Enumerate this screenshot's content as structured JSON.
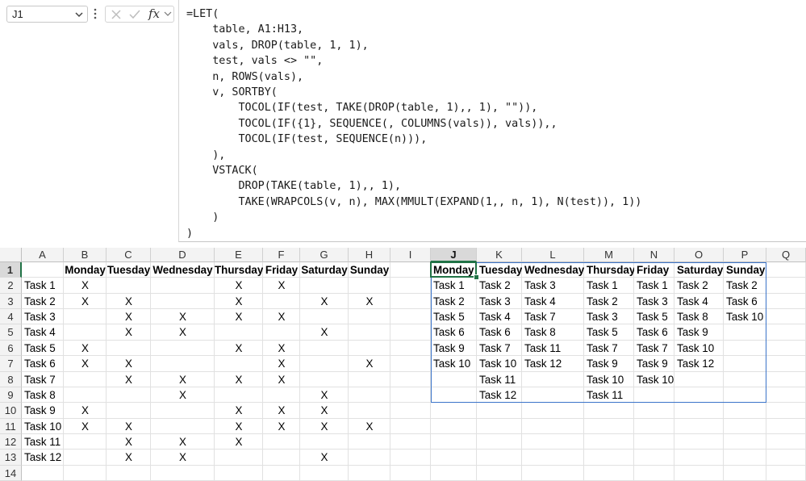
{
  "name_box": {
    "value": "J1"
  },
  "formula_bar": {
    "fx_label": "fx",
    "lines": [
      "=LET(",
      "    table, A1:H13,",
      "    vals, DROP(table, 1, 1),",
      "    test, vals <> \"\",",
      "    n, ROWS(vals),",
      "    v, SORTBY(",
      "        TOCOL(IF(test, TAKE(DROP(table, 1),, 1), \"\")),",
      "        TOCOL(IF({1}, SEQUENCE(, COLUMNS(vals)), vals)),,",
      "        TOCOL(IF(test, SEQUENCE(n))),",
      "    ),",
      "    VSTACK(",
      "        DROP(TAKE(table, 1),, 1),",
      "        TAKE(WRAPCOLS(v, n), MAX(MMULT(EXPAND(1,, n, 1), N(test)), 1))",
      "    )",
      ")"
    ]
  },
  "grid": {
    "columns": [
      "A",
      "B",
      "C",
      "D",
      "E",
      "F",
      "G",
      "H",
      "I",
      "J",
      "K",
      "L",
      "M",
      "N",
      "O",
      "P",
      "Q"
    ],
    "selected_column": "J",
    "rows": [
      "1",
      "2",
      "3",
      "4",
      "5",
      "6",
      "7",
      "8",
      "9",
      "10",
      "11",
      "12",
      "13",
      "14"
    ],
    "selected_row": "1",
    "source_table": {
      "headers": [
        "Monday",
        "Tuesday",
        "Wednesday",
        "Thursday",
        "Friday",
        "Saturday",
        "Sunday"
      ],
      "tasks": [
        "Task 1",
        "Task 2",
        "Task 3",
        "Task 4",
        "Task 5",
        "Task 6",
        "Task 7",
        "Task 8",
        "Task 9",
        "Task 10",
        "Task 11",
        "Task 12"
      ],
      "marks": [
        [
          "X",
          "",
          "",
          "X",
          "X",
          "",
          ""
        ],
        [
          "X",
          "X",
          "",
          "X",
          "",
          "X",
          "X"
        ],
        [
          "",
          "X",
          "X",
          "X",
          "X",
          "",
          ""
        ],
        [
          "",
          "X",
          "X",
          "",
          "",
          "X",
          ""
        ],
        [
          "X",
          "",
          "",
          "X",
          "X",
          "",
          ""
        ],
        [
          "X",
          "X",
          "",
          "",
          "X",
          "",
          "X"
        ],
        [
          "",
          "X",
          "X",
          "X",
          "X",
          "",
          ""
        ],
        [
          "",
          "",
          "X",
          "",
          "",
          "X",
          ""
        ],
        [
          "X",
          "",
          "",
          "X",
          "X",
          "X",
          ""
        ],
        [
          "X",
          "X",
          "",
          "X",
          "X",
          "X",
          "X"
        ],
        [
          "",
          "X",
          "X",
          "X",
          "",
          "",
          ""
        ],
        [
          "",
          "X",
          "X",
          "",
          "",
          "X",
          ""
        ]
      ]
    },
    "result_table": {
      "headers": [
        "Monday",
        "Tuesday",
        "Wednesday",
        "Thursday",
        "Friday",
        "Saturday",
        "Sunday"
      ],
      "columns": [
        [
          "Task 1",
          "Task 2",
          "Task 5",
          "Task 6",
          "Task 9",
          "Task 10",
          ""
        ],
        [
          "Task 2",
          "Task 3",
          "Task 4",
          "Task 6",
          "Task 7",
          "Task 10",
          "Task 11",
          "Task 12"
        ],
        [
          "Task 3",
          "Task 4",
          "Task 7",
          "Task 8",
          "Task 11",
          "Task 12"
        ],
        [
          "Task 1",
          "Task 2",
          "Task 3",
          "Task 5",
          "Task 7",
          "Task 9",
          "Task 10",
          "Task 11"
        ],
        [
          "Task 1",
          "Task 3",
          "Task 5",
          "Task 6",
          "Task 7",
          "Task 9",
          "Task 10"
        ],
        [
          "Task 2",
          "Task 4",
          "Task 8",
          "Task 9",
          "Task 10",
          "Task 12"
        ],
        [
          "Task 2",
          "Task 6",
          "Task 10"
        ]
      ]
    }
  },
  "colors": {
    "active_cell": "#217346",
    "spill_border": "#3b74c9"
  }
}
